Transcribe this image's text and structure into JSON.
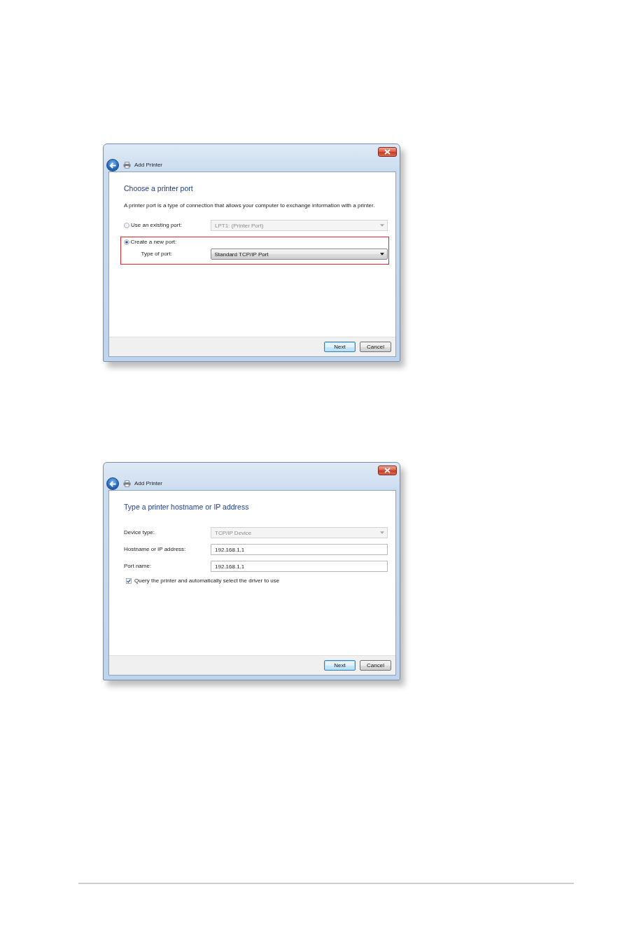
{
  "dialogs": [
    {
      "title": "Add Printer",
      "heading": "Choose a printer port",
      "description": "A printer port is a type of connection that allows your computer to exchange information with a printer.",
      "items": [
        {
          "kind": "radio",
          "label": "Use an existing port:",
          "selected": false,
          "highlighted": false,
          "select": {
            "value": "LPT1: (Printer Port)",
            "disabled": true
          }
        },
        {
          "kind": "radio",
          "label": "Create a new port:",
          "selected": true,
          "highlighted": true,
          "sub": {
            "label": "Type of port:",
            "select": {
              "value": "Standard TCP/IP Port",
              "disabled": false
            }
          }
        }
      ],
      "buttons": [
        {
          "label": "Next",
          "default": true
        },
        {
          "label": "Cancel",
          "default": false
        }
      ]
    },
    {
      "title": "Add Printer",
      "heading": "Type a printer hostname or IP address",
      "items": [
        {
          "kind": "field",
          "label": "Device type:",
          "select": {
            "value": "TCP/IP Device",
            "disabled": true
          }
        },
        {
          "kind": "field",
          "label": "Hostname or IP address:",
          "input": {
            "value": "192.168.1.1"
          }
        },
        {
          "kind": "field",
          "label": "Port name:",
          "input": {
            "value": "192.168.1.1"
          }
        },
        {
          "kind": "checkbox",
          "label": "Query the printer and automatically select the driver to use",
          "checked": true
        }
      ],
      "buttons": [
        {
          "label": "Next",
          "default": true
        },
        {
          "label": "Cancel",
          "default": false
        }
      ]
    }
  ]
}
